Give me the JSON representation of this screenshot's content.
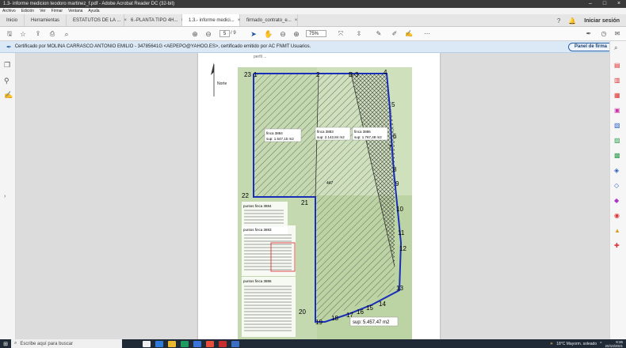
{
  "window": {
    "title": "1.3- informe medicion teodoro martinez_f.pdf - Adobe Acrobat Reader DC (32-bit)"
  },
  "menu": [
    "Archivo",
    "Edición",
    "Ver",
    "Firmar",
    "Ventana",
    "Ayuda"
  ],
  "tabs": {
    "home": "Inicio",
    "tools": "Herramientas",
    "docs": [
      "ESTATUTOS DE LA ...",
      "6.-PLANTA TIPO 4H...",
      "1.3.- informe medici...",
      "firmado_contrato_e..."
    ],
    "signin": "Iniciar sesión"
  },
  "toolbar": {
    "page_current": "5",
    "page_total": "/ 9",
    "zoom": "75%"
  },
  "signature": {
    "message": "Certificado por MOLINA CARRASCO ANTONIO EMILIO - 34785641G <AEPEPO@YAHOO.ES>, certificado emitido por AC FNMT Usuarios.",
    "button": "Panel de firma"
  },
  "plan": {
    "header_text": "perfil ...",
    "north": "Norte",
    "vertices": [
      "23",
      "1",
      "2",
      "B-3",
      "4",
      "5",
      "6",
      "7",
      "8",
      "9",
      "10",
      "11",
      "12",
      "13",
      "14",
      "15",
      "16",
      "17",
      "18",
      "19",
      "20",
      "21",
      "22"
    ],
    "parcels": [
      {
        "name": "finca 3884",
        "area": "sup: 1.547,15 m2"
      },
      {
        "name": "finca 3883",
        "area": "sup: 2.142,84 m2"
      },
      {
        "name": "finca 3886",
        "area": "sup: 1.767,48 m2"
      }
    ],
    "center_label": "447",
    "total_area": "sup: 5.457,47 m2",
    "coord_titles": [
      "puntos finca 3884",
      "puntos finca 3883",
      "puntos finca 3886"
    ]
  },
  "taskbar": {
    "search": "Escribe aquí para buscar",
    "weather": "18°C  Mayorm. soleado",
    "time": "9:36",
    "date": "20/10/2021"
  }
}
